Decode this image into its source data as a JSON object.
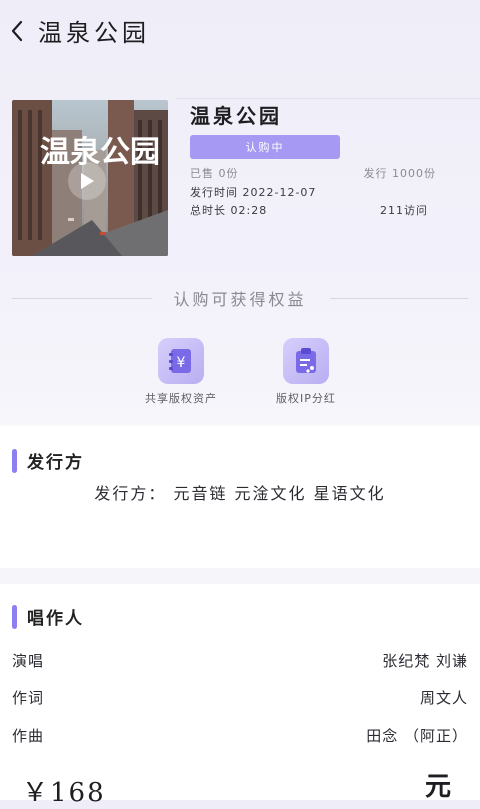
{
  "header": {
    "title": "温泉公园"
  },
  "song": {
    "cover_text": "温泉公园",
    "title": "温泉公园",
    "subscribe_label": "认购中",
    "owned": "已售 0份",
    "issued": "发行 1000份",
    "release_date": "发行时间 2022-12-07",
    "duration": "总时长 02:28",
    "visits": "211访问"
  },
  "benefits": {
    "title": "认购可获得权益",
    "items": [
      {
        "label": "共享版权资产",
        "icon": "yuan-notebook-icon"
      },
      {
        "label": "版权IP分红",
        "icon": "clipboard-share-icon"
      }
    ]
  },
  "publisher": {
    "heading": "发行方",
    "text": "发行方： 元音链 元淦文化 星语文化"
  },
  "creators": {
    "heading": "唱作人",
    "rows": [
      {
        "label": "演唱",
        "value": "张纪梵 刘谦"
      },
      {
        "label": "作词",
        "value": "周文人"
      },
      {
        "label": "作曲",
        "value": "田念 （阿正）"
      }
    ]
  },
  "footer": {
    "price": "￥168",
    "logo": "元"
  },
  "colors": {
    "accent": "#8c7ff0",
    "button": "#a699f3"
  }
}
